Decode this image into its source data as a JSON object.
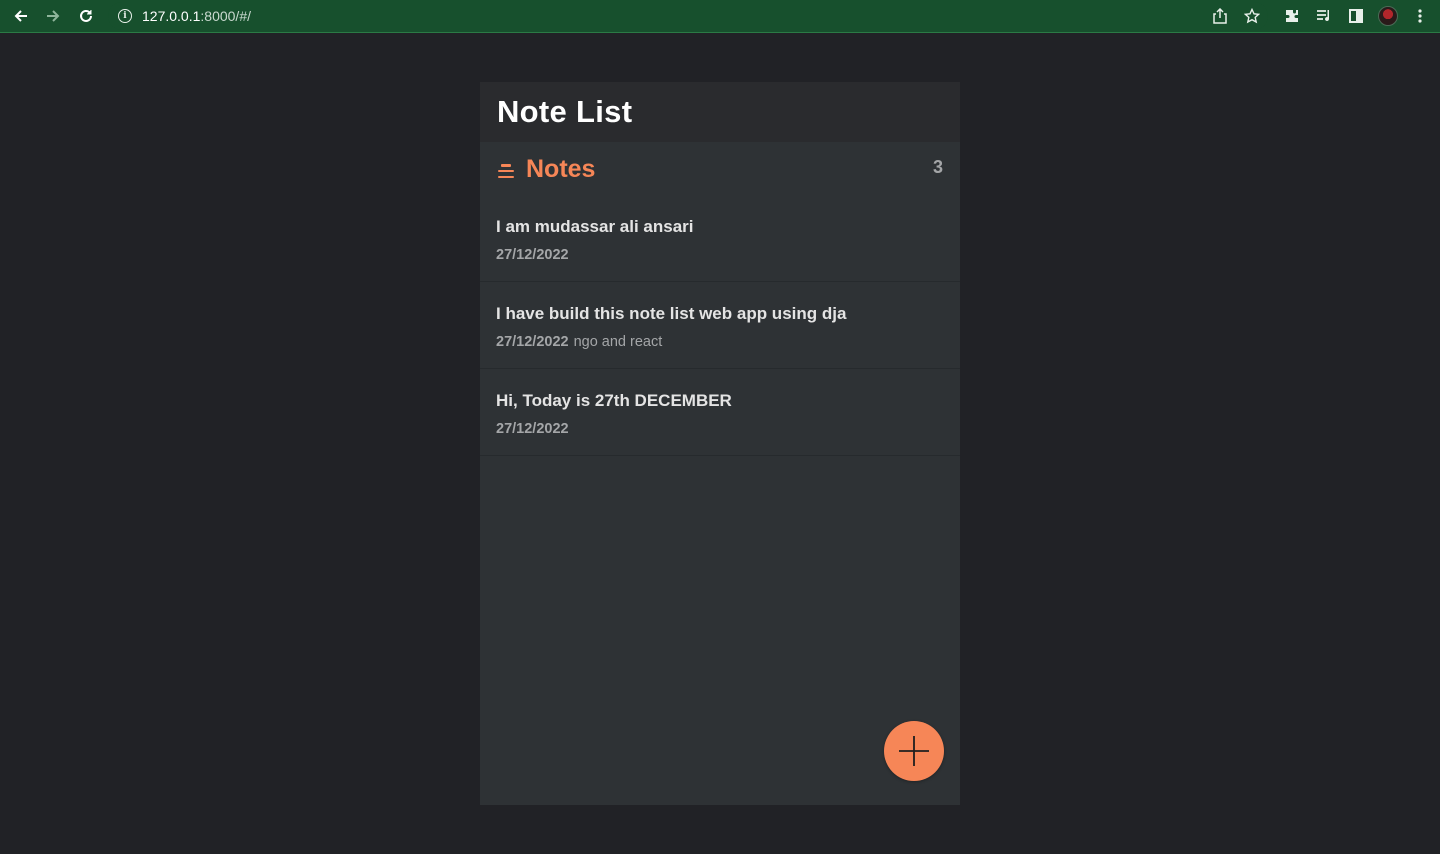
{
  "browser": {
    "url_host": "127.0.0.1",
    "url_rest": ":8000/#/",
    "back_icon": "back-arrow-icon",
    "forward_icon": "forward-arrow-icon",
    "reload_icon": "reload-icon"
  },
  "app": {
    "title": "Note List"
  },
  "notes_section": {
    "title": "Notes",
    "count": "3",
    "accent_color": "#f68657"
  },
  "notes": [
    {
      "title": "I am mudassar ali ansari",
      "date": "27/12/2022",
      "preview": ""
    },
    {
      "title": "I have build this note list web app using dja",
      "date": "27/12/2022",
      "preview": "ngo and react"
    },
    {
      "title": "Hi, Today is 27th DECEMBER",
      "date": "27/12/2022",
      "preview": ""
    }
  ],
  "add_button": {
    "icon": "plus-icon",
    "color": "#f68657"
  }
}
